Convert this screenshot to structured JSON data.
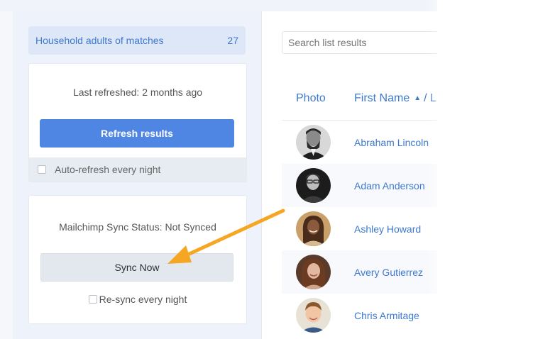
{
  "sidebar": {
    "list_header": {
      "title": "Household adults of matches",
      "count": "27"
    },
    "refresh_card": {
      "last_refreshed": "Last refreshed: 2 months ago",
      "refresh_button": "Refresh results",
      "auto_refresh_label": "Auto-refresh every night"
    },
    "sync_card": {
      "status": "Mailchimp Sync Status: Not Synced",
      "sync_button": "Sync Now",
      "resync_label": "Re-sync every night"
    }
  },
  "main": {
    "search_placeholder": "Search list results",
    "columns": {
      "photo": "Photo",
      "first_name": "First Name",
      "sort_glyph": "▲",
      "next_col_partial": "/ L"
    },
    "rows": [
      {
        "name": "Abraham Lincoln",
        "avatar": "abraham-lincoln-avatar"
      },
      {
        "name": "Adam Anderson",
        "avatar": "adam-anderson-avatar"
      },
      {
        "name": "Ashley Howard",
        "avatar": "ashley-howard-avatar"
      },
      {
        "name": "Avery Gutierrez",
        "avatar": "avery-gutierrez-avatar"
      },
      {
        "name": "Chris Armitage",
        "avatar": "chris-armitage-avatar"
      }
    ]
  },
  "colors": {
    "accent": "#3d79cf",
    "primary_button": "#4f86e4",
    "annotation_arrow": "#f5a623"
  },
  "annotation": {
    "type": "arrow-icon",
    "points_to": "sync-now-button"
  }
}
